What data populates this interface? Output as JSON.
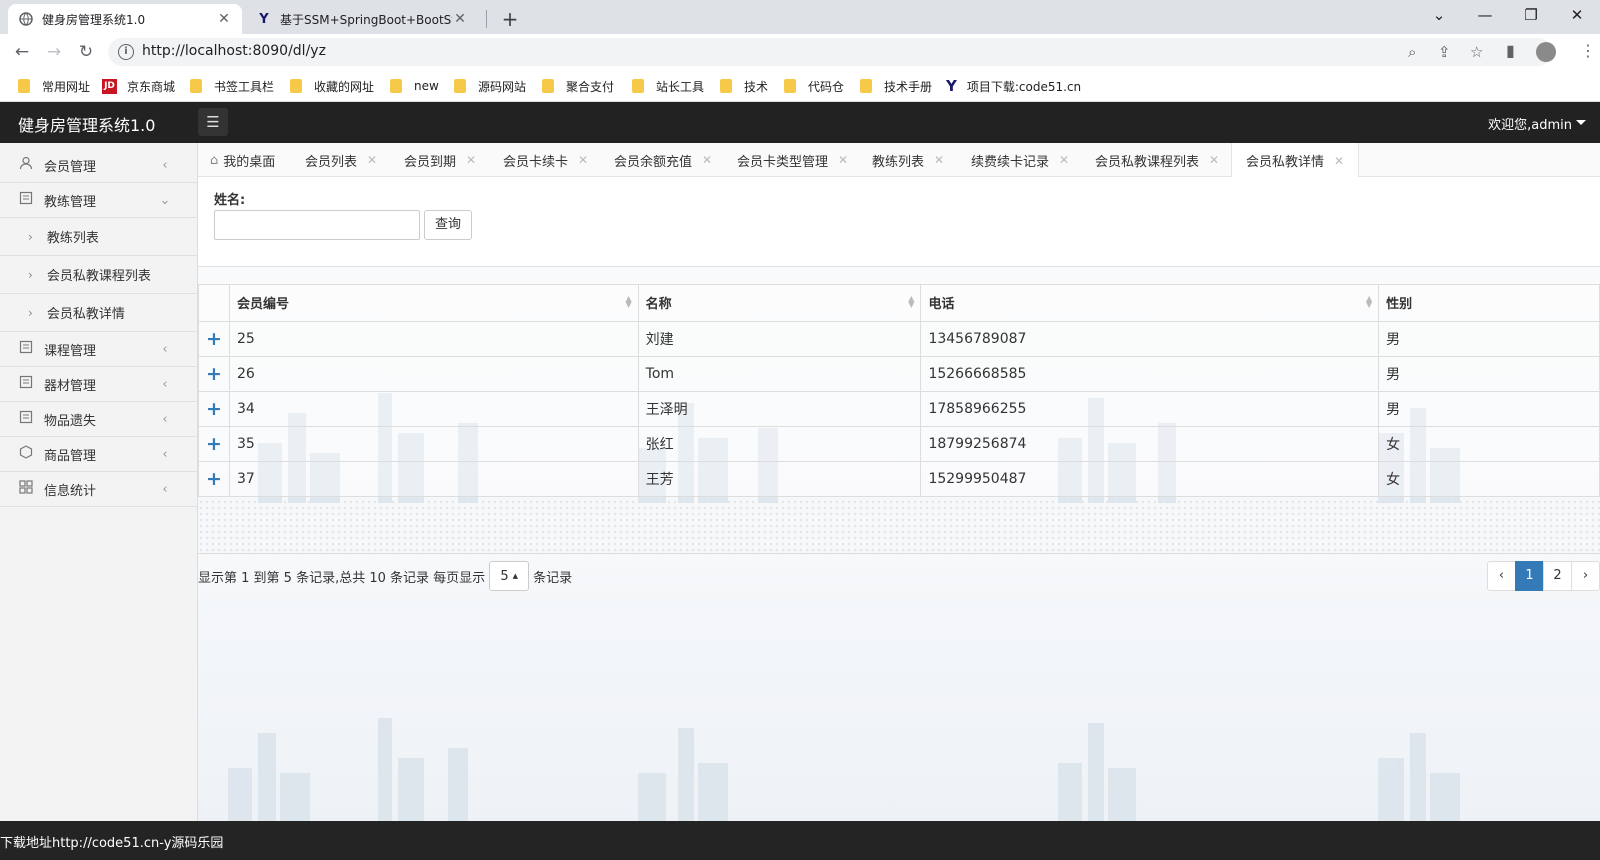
{
  "browser": {
    "tabs": [
      {
        "title": "健身房管理系统1.0",
        "active": true
      },
      {
        "title": "基于SSM+SpringBoot+BootSt",
        "active": false
      }
    ],
    "url": "http://localhost:8090/dl/yz",
    "bookmarks": [
      "常用网址",
      "京东商城",
      "书签工具栏",
      "收藏的网址",
      "new",
      "源码网站",
      "聚合支付",
      "站长工具",
      "技术",
      "代码仓",
      "技术手册",
      "项目下载:code51.cn"
    ]
  },
  "app": {
    "title": "健身房管理系统1.0",
    "welcome": "欢迎您,admin"
  },
  "sidebar": {
    "items": [
      {
        "label": "会员管理",
        "icon": "user-icon"
      },
      {
        "label": "教练管理",
        "icon": "document-icon"
      },
      {
        "label": "课程管理",
        "icon": "document-icon"
      },
      {
        "label": "器材管理",
        "icon": "document-icon"
      },
      {
        "label": "物品遗失",
        "icon": "document-icon"
      },
      {
        "label": "商品管理",
        "icon": "cube-icon"
      },
      {
        "label": "信息统计",
        "icon": "grid-icon"
      }
    ],
    "subitems": [
      "教练列表",
      "会员私教课程列表",
      "会员私教详情"
    ]
  },
  "page_tabs": [
    "我的桌面",
    "会员列表",
    "会员到期",
    "会员卡续卡",
    "会员余额充值",
    "会员卡类型管理",
    "教练列表",
    "续费续卡记录",
    "会员私教课程列表",
    "会员私教详情"
  ],
  "search": {
    "label": "姓名:",
    "value": "",
    "button": "查询"
  },
  "table": {
    "columns": [
      "会员编号",
      "名称",
      "电话",
      "性别"
    ],
    "expand_symbol": "+",
    "rows": [
      [
        "25",
        "刘建",
        "13456789087",
        "男"
      ],
      [
        "26",
        "Tom",
        "15266668585",
        "男"
      ],
      [
        "34",
        "王泽明",
        "17858966255",
        "男"
      ],
      [
        "35",
        "张红",
        "18799256874",
        "女"
      ],
      [
        "37",
        "王芳",
        "15299950487",
        "女"
      ]
    ]
  },
  "pager": {
    "info_prefix": "显示第 1 到第 5 条记录,总共 10 条记录 每页显示",
    "page_size": "5",
    "info_suffix": "条记录",
    "prev": "‹",
    "pages": [
      "1",
      "2"
    ],
    "next": "›",
    "current_page": "1"
  },
  "footer": {
    "text": "下载地址http://code51.cn-y源码乐园"
  },
  "colors": {
    "header_bg": "#222222",
    "sidebar_bg": "#f3f3f4",
    "primary": "#337ab7",
    "footer_bg": "#242424"
  }
}
